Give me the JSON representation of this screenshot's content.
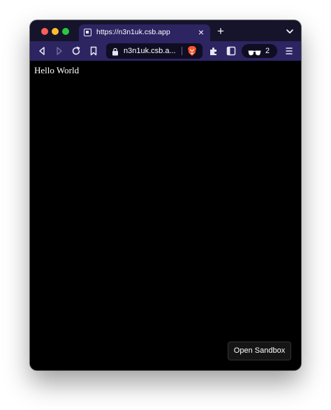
{
  "browser": {
    "tab": {
      "title": "https://n3n1uk.csb.app",
      "close_glyph": "×",
      "favicon": "codesandbox-icon"
    },
    "new_tab_glyph": "+",
    "address_bar": {
      "display_text": "n3n1uk.csb.a..."
    },
    "wallet": {
      "count": "2",
      "icon": "sunglasses-icon"
    },
    "icons": [
      "back-icon",
      "forward-icon",
      "reload-icon",
      "bookmark-icon",
      "lock-icon",
      "brave-shield-icon",
      "extensions-icon",
      "sidebar-icon",
      "menu-icon",
      "tab-list-chevron-icon"
    ]
  },
  "page": {
    "heading": "Hello World",
    "open_sandbox_label": "Open Sandbox"
  },
  "colors": {
    "titlebar": "#16142b",
    "toolbar": "#2d2462",
    "urlbar": "#0f0d22",
    "content_bg": "#000000",
    "brave_orange": "#fb542b"
  }
}
